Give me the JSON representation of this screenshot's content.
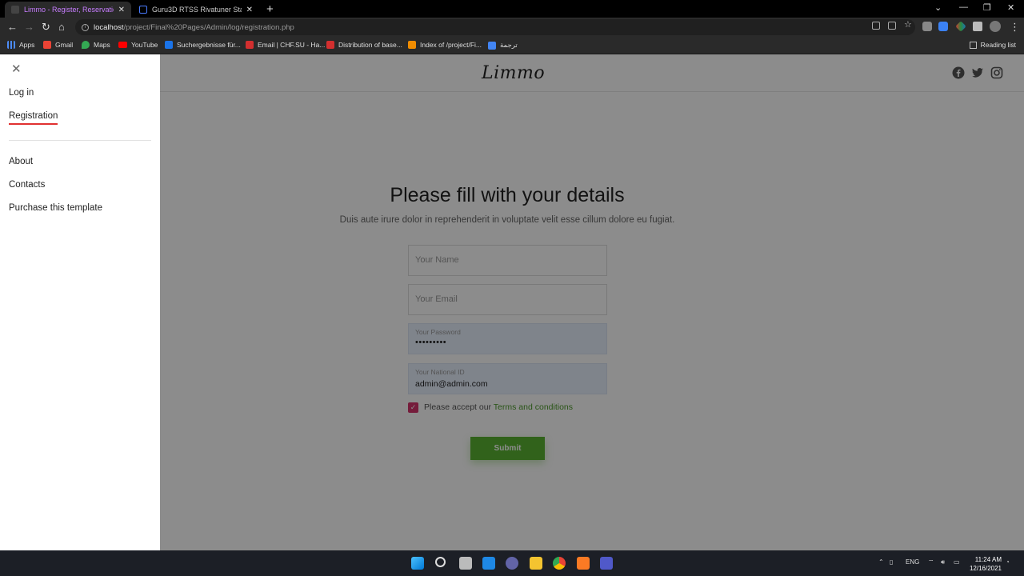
{
  "browser": {
    "tabs": [
      {
        "title": "Limmo - Register, Reservation, Q",
        "active": true
      },
      {
        "title": "Guru3D RTSS Rivatuner Statistics",
        "active": false
      }
    ],
    "url_host": "localhost",
    "url_path": "/project/Final%20Pages/Admin/log/registration.php",
    "bookmarks": [
      "Apps",
      "Gmail",
      "Maps",
      "YouTube",
      "Suchergebnisse für...",
      "Email | CHF.SU - Ha...",
      "Distribution of base...",
      "Index of /project/Fi...",
      "ترجمة"
    ],
    "reading_list": "Reading list"
  },
  "site": {
    "logo": "Limmo",
    "social_icons": [
      "facebook-icon",
      "twitter-icon",
      "instagram-icon"
    ]
  },
  "menu": {
    "items": [
      {
        "label": "Log in"
      },
      {
        "label": "Registration",
        "active": true
      },
      {
        "label": "About"
      },
      {
        "label": "Contacts"
      },
      {
        "label": "Purchase this template"
      }
    ]
  },
  "form": {
    "title": "Please fill with your details",
    "subtitle": "Duis aute irure dolor in reprehenderit in voluptate velit esse cillum dolore eu fugiat.",
    "name_placeholder": "Your Name",
    "email_placeholder": "Your Email",
    "password_label": "Your Password",
    "password_value": "•••••••••",
    "national_id_label": "Your National ID",
    "national_id_value": "admin@admin.com",
    "accept_text": "Please accept our",
    "terms_text": "Terms and conditions",
    "accepted": true,
    "submit_label": "Submit"
  },
  "taskbar": {
    "language": "ENG",
    "time": "11:24 AM",
    "date": "12/16/2021"
  }
}
